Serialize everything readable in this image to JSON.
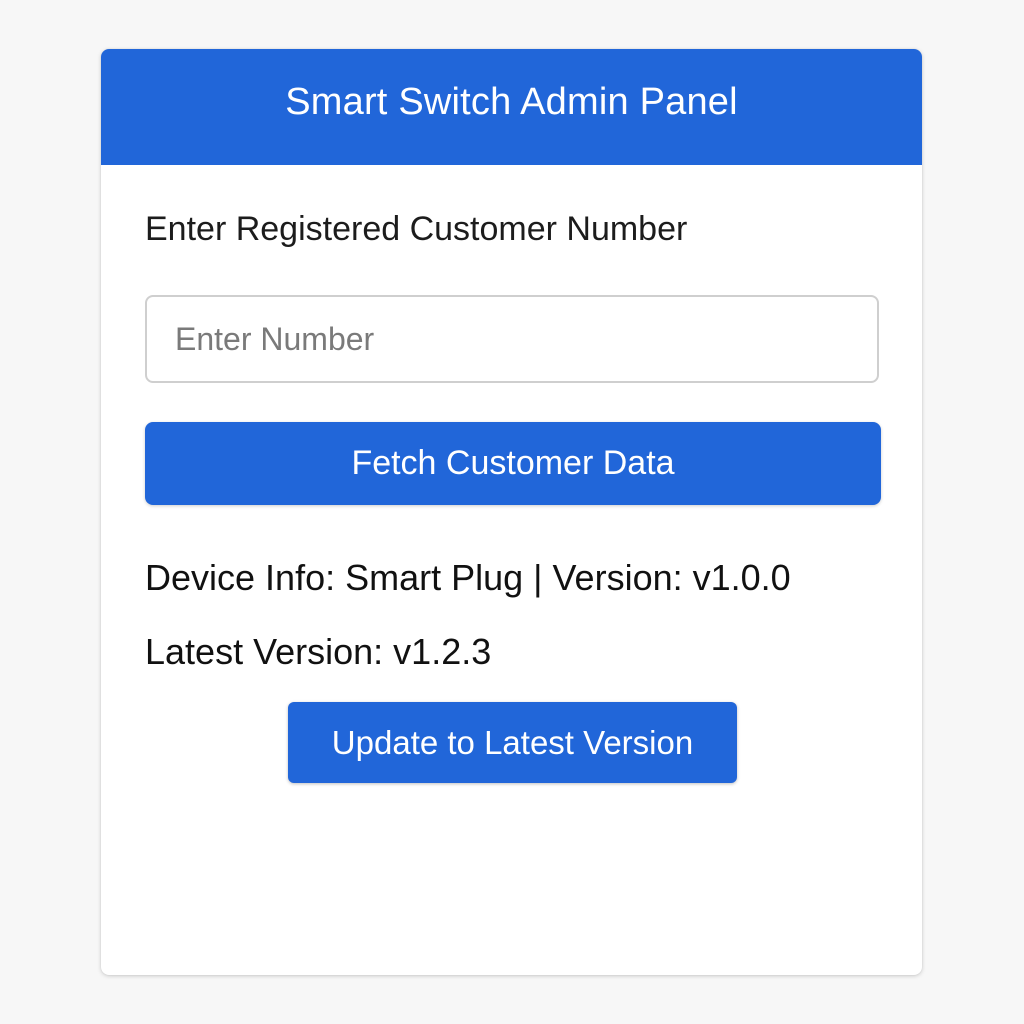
{
  "header": {
    "title": "Smart Switch Admin Panel"
  },
  "form": {
    "label": "Enter Registered Customer Number",
    "input_value": "",
    "input_placeholder": "Enter Number",
    "fetch_button_label": "Fetch Customer Data"
  },
  "device": {
    "info_key": "Device Info:",
    "info_value": "Smart Plug | Version: v1.0.0",
    "latest_key": "Latest Version:",
    "latest_value": "v1.2.3"
  },
  "actions": {
    "update_button_label": "Update to Latest Version"
  },
  "colors": {
    "accent": "#2166d9",
    "background": "#f7f7f7",
    "panel": "#ffffff"
  }
}
